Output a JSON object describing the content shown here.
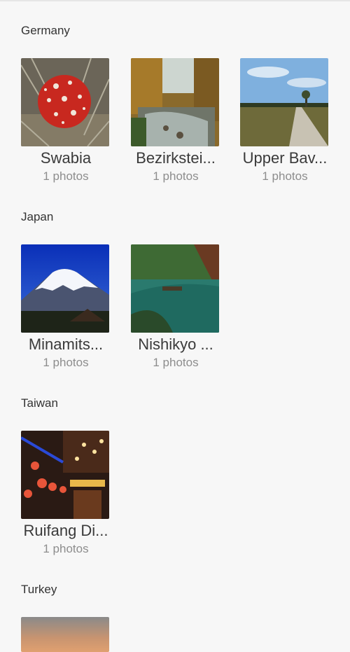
{
  "sections": [
    {
      "country": "Germany",
      "albums": [
        {
          "name": "Swabia",
          "count": "1 photos"
        },
        {
          "name": "Bezirkstei...",
          "count": "1 photos"
        },
        {
          "name": "Upper Bav...",
          "count": "1 photos"
        }
      ]
    },
    {
      "country": "Japan",
      "albums": [
        {
          "name": "Minamits...",
          "count": "1 photos"
        },
        {
          "name": "Nishikyo ...",
          "count": "1 photos"
        }
      ]
    },
    {
      "country": "Taiwan",
      "albums": [
        {
          "name": "Ruifang Di...",
          "count": "1 photos"
        }
      ]
    },
    {
      "country": "Turkey",
      "albums": []
    }
  ]
}
